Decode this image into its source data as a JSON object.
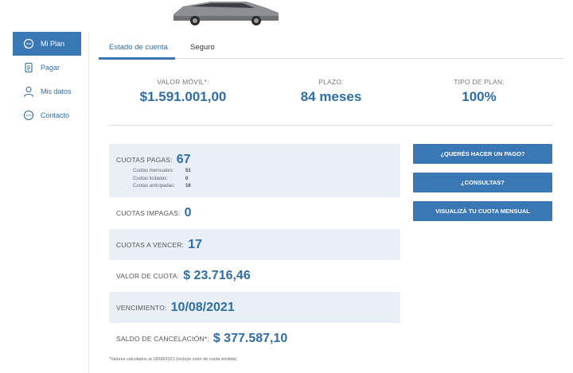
{
  "sidebar": {
    "items": [
      {
        "label": "Mi Plan",
        "icon": "chat-bubble-icon"
      },
      {
        "label": "Pagar",
        "icon": "receipt-icon"
      },
      {
        "label": "Mis datos",
        "icon": "user-icon"
      },
      {
        "label": "Contacto",
        "icon": "chat-dots-icon"
      }
    ]
  },
  "tabs": [
    {
      "label": "Estado de cuenta"
    },
    {
      "label": "Seguro"
    }
  ],
  "summary": {
    "valor_movil_label": "VALOR MÓVIL*:",
    "valor_movil_value": "$1.591.001,00",
    "plazo_label": "PLAZO:",
    "plazo_value": "84 meses",
    "tipo_plan_label": "TIPO DE PLAN:",
    "tipo_plan_value": "100%"
  },
  "cuotas": {
    "pagas_label": "CUOTAS PAGAS:",
    "pagas_value": "67",
    "mensuales_label": "Cuotas mensuales:",
    "mensuales_value": "51",
    "licitadas_label": "Cuotas licitadas:",
    "licitadas_value": "0",
    "anticipadas_label": "Cuotas anticipadas:",
    "anticipadas_value": "16",
    "impagas_label": "CUOTAS IMPAGAS:",
    "impagas_value": "0",
    "vencer_label": "CUOTAS A VENCER:",
    "vencer_value": "17",
    "valor_cuota_label": "VALOR DE CUOTA:",
    "valor_cuota_value": "$ 23.716,46",
    "vencimiento_label": "VENCIMIENTO:",
    "vencimiento_value": "10/08/2021",
    "saldo_label": "SALDO DE CANCELACIÓN*:",
    "saldo_value": "$ 377.587,10"
  },
  "actions": {
    "pago": "¿QUERÉS HACER UN PAGO?",
    "consultas": "¿CONSULTAS?",
    "cuota": "VISUALIZÁ TU CUOTA MENSUAL"
  },
  "footnote": "*Valores calculados al 18/08/2021 (incluye valor de cuota emitida)",
  "colors": {
    "accent": "#3a78b5",
    "value_blue": "#2f6da6",
    "row_shade": "#e8eff6"
  }
}
